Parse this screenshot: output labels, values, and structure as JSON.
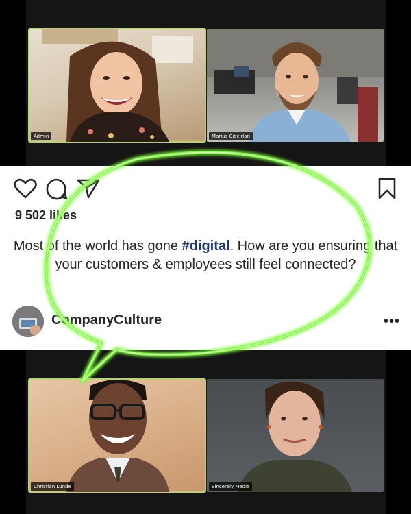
{
  "call": {
    "participants": [
      {
        "name": "Admin",
        "active": true
      },
      {
        "name": "Marius Ciocirlan",
        "active": false
      },
      {
        "name": "Christian Lunde",
        "active": true
      },
      {
        "name": "Sincerely Media",
        "active": false
      }
    ],
    "active_border_color": "#b9d46a"
  },
  "post": {
    "actions": [
      "heart-icon",
      "comment-icon",
      "share-icon",
      "bookmark-icon"
    ],
    "likes": "9 502 likes",
    "caption": {
      "part1": "Most of the world has gone ",
      "hashtag": "#digital",
      "part2": ". How are you ensuring that your customers & employees still feel connected?"
    },
    "account": "CompanyCulture",
    "more_label": "•••",
    "hashtag_color": "#1f3b6e"
  },
  "overlay": {
    "speech_bubble_color": "#7dff3c"
  }
}
